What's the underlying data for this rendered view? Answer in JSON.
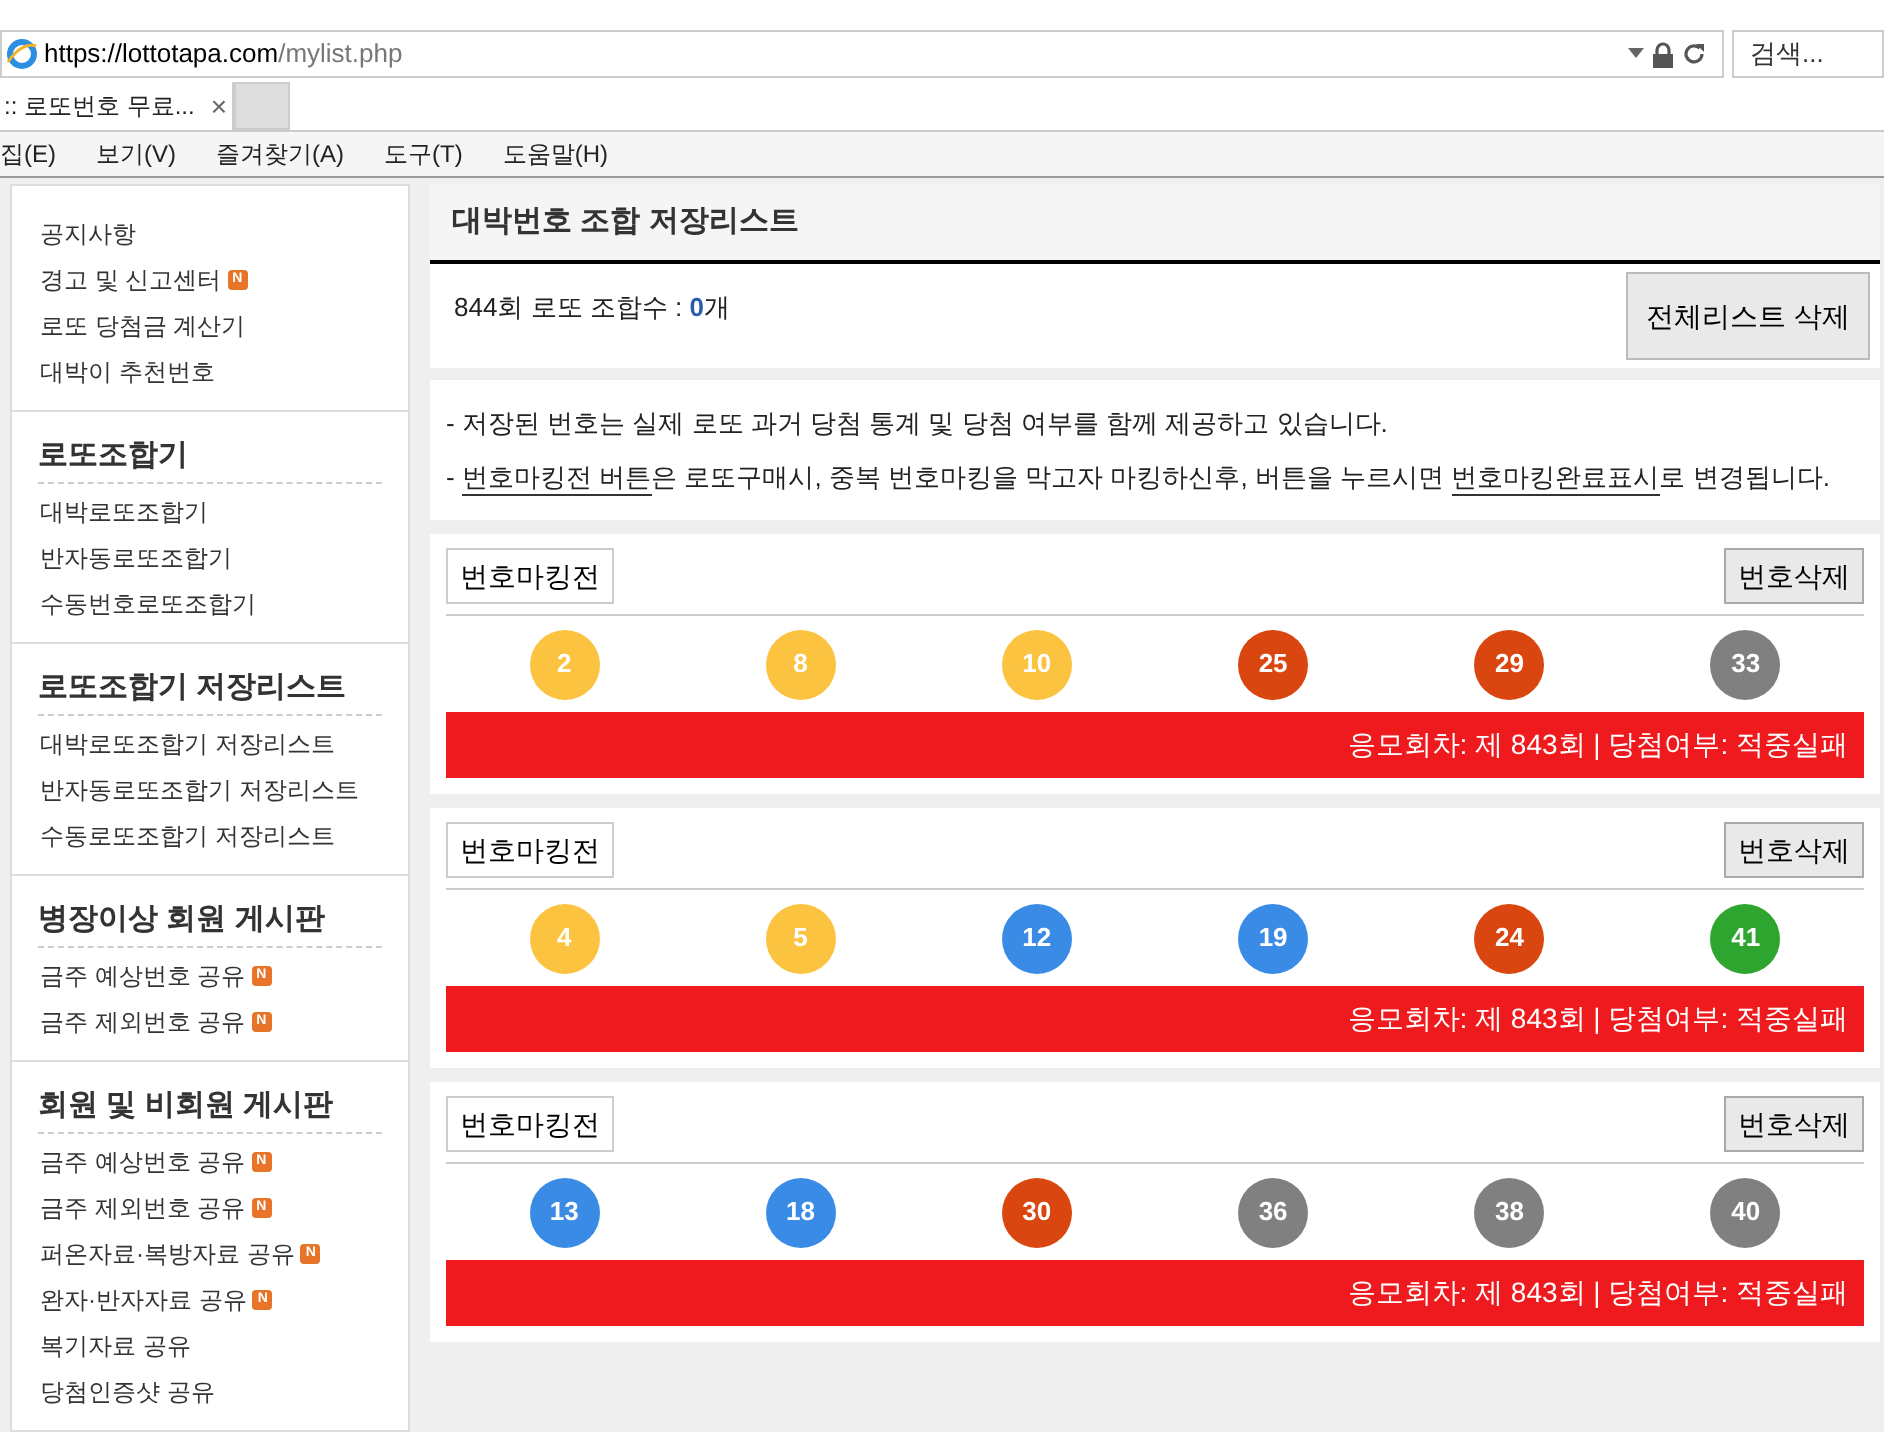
{
  "browser": {
    "url_host": "https://lottotapa.com",
    "url_path": "/mylist.php",
    "search_placeholder": "검색...",
    "tabs": [
      {
        "label": ":: 로또번호 무료...",
        "selected": true,
        "close": "×"
      },
      {
        "selected": false
      }
    ],
    "menu": [
      "집(E)",
      "보기(V)",
      "즐겨찾기(A)",
      "도구(T)",
      "도움말(H)"
    ]
  },
  "sidebar": {
    "sections": [
      {
        "items": [
          {
            "label": "공지사항"
          },
          {
            "label": "경고 및 신고센터",
            "badge": "N"
          },
          {
            "label": "로또 당첨금 계산기"
          },
          {
            "label": "대박이 추천번호"
          }
        ]
      },
      {
        "title": "로또조합기",
        "items": [
          {
            "label": "대박로또조합기"
          },
          {
            "label": "반자동로또조합기"
          },
          {
            "label": "수동번호로또조합기"
          }
        ]
      },
      {
        "title": "로또조합기 저장리스트",
        "items": [
          {
            "label": "대박로또조합기 저장리스트"
          },
          {
            "label": "반자동로또조합기 저장리스트"
          },
          {
            "label": "수동로또조합기 저장리스트"
          }
        ]
      },
      {
        "title": "병장이상 회원 게시판",
        "items": [
          {
            "label": "금주 예상번호 공유",
            "badge": "N"
          },
          {
            "label": "금주 제외번호 공유",
            "badge": "N"
          }
        ]
      },
      {
        "title": "회원 및 비회원 게시판",
        "items": [
          {
            "label": "금주 예상번호 공유",
            "badge": "N"
          },
          {
            "label": "금주 제외번호 공유",
            "badge": "N"
          },
          {
            "label": "퍼온자료·복방자료 공유",
            "badge": "N"
          },
          {
            "label": "완자·반자자료 공유",
            "badge": "N"
          },
          {
            "label": "복기자료 공유"
          },
          {
            "label": "당첨인증샷 공유"
          }
        ]
      }
    ]
  },
  "main": {
    "title": "대박번호 조합 저장리스트",
    "count_text": "844회 로또 조합수 : **0**개",
    "delete_all": "전체리스트 삭제",
    "notices": [
      [
        {
          "text": "- 저장된 번호는 실제 로또 과거 당첨 통계 및 당첨 여부를 함께 제공하고 있습니다.",
          "underline": false
        }
      ],
      [
        {
          "text": "- ",
          "underline": false
        },
        {
          "text": "번호마킹전 버튼",
          "underline": true
        },
        {
          "text": "은 로또구매시, 중복 번호마킹을 막고자 마킹하신후, 버튼을 누르시면 ",
          "underline": false
        },
        {
          "text": "번호마킹완료표시",
          "underline": true
        },
        {
          "text": "로 변경됩니다.",
          "underline": false
        }
      ]
    ],
    "combos": [
      {
        "mark_button": "번호마킹전",
        "delete_button": "번호삭제",
        "balls": [
          {
            "number": "2",
            "color": "#fbc33f"
          },
          {
            "number": "8",
            "color": "#fbc33f"
          },
          {
            "number": "10",
            "color": "#fbc33f"
          },
          {
            "number": "25",
            "color": "#d9460f"
          },
          {
            "number": "29",
            "color": "#d9460f"
          },
          {
            "number": "33",
            "color": "#808080"
          }
        ],
        "result": "응모회차: 제 843회 | 당첨여부: 적중실패"
      },
      {
        "mark_button": "번호마킹전",
        "delete_button": "번호삭제",
        "balls": [
          {
            "number": "4",
            "color": "#fbc33f"
          },
          {
            "number": "5",
            "color": "#fbc33f"
          },
          {
            "number": "12",
            "color": "#3a8be6"
          },
          {
            "number": "19",
            "color": "#3a8be6"
          },
          {
            "number": "24",
            "color": "#d9460f"
          },
          {
            "number": "41",
            "color": "#2ea52e"
          }
        ],
        "result": "응모회차: 제 843회 | 당첨여부: 적중실패"
      },
      {
        "mark_button": "번호마킹전",
        "delete_button": "번호삭제",
        "balls": [
          {
            "number": "13",
            "color": "#3a8be6"
          },
          {
            "number": "18",
            "color": "#3a8be6"
          },
          {
            "number": "30",
            "color": "#d9460f"
          },
          {
            "number": "36",
            "color": "#808080"
          },
          {
            "number": "38",
            "color": "#808080"
          },
          {
            "number": "40",
            "color": "#808080"
          }
        ],
        "result": "응모회차: 제 843회 | 당첨여부: 적중실패"
      }
    ]
  }
}
